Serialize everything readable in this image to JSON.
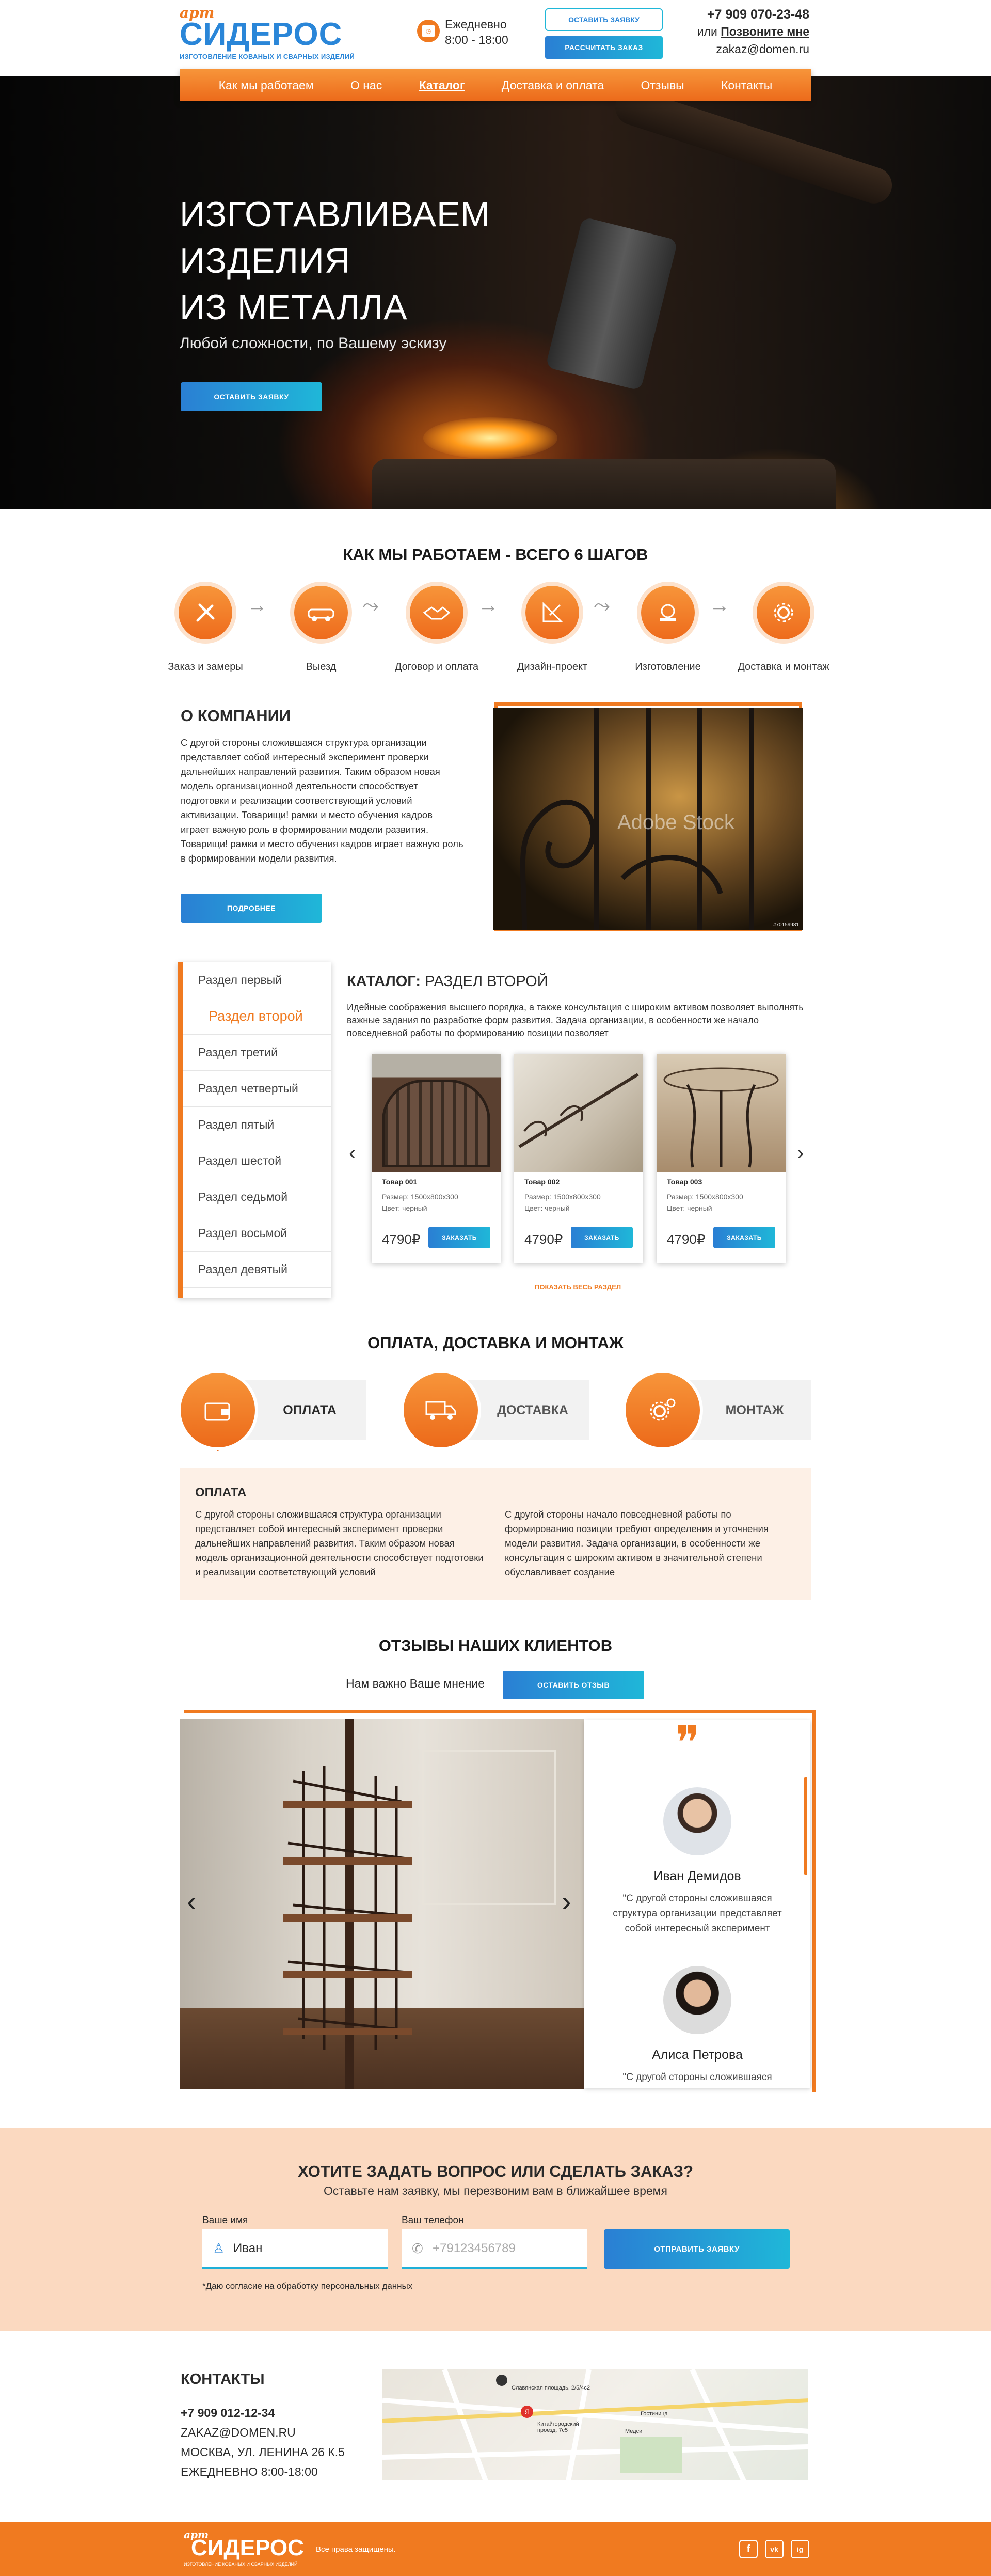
{
  "header": {
    "logo_top": "арт",
    "logo_main": "СИДЕРОС",
    "logo_sub": "изготовление кованых и сварных изделий",
    "hours_label": "Ежедневно",
    "hours": "8:00 - 18:00",
    "btn_request": "ОСТАВИТЬ ЗАЯВКУ",
    "btn_calc": "РАССЧИТАТЬ ЗАКАЗ",
    "phone": "+7 909 070-23-48",
    "or": "или",
    "callback": "Позвоните мне",
    "email": "zakaz@domen.ru"
  },
  "nav": [
    "Как мы работаем",
    "О нас",
    "Каталог",
    "Доставка и оплата",
    "Отзывы",
    "Контакты"
  ],
  "hero": {
    "line1": "ИЗГОТАВЛИВАЕМ",
    "line2": "ИЗДЕЛИЯ",
    "line3": "ИЗ МЕТАЛЛА",
    "subtitle": "Любой сложности, по Вашему эскизу",
    "button": "ОСТАВИТЬ ЗАЯВКУ"
  },
  "steps": {
    "title": "КАК МЫ РАБОТАЕМ - ВСЕГО 6 ШАГОВ",
    "items": [
      "Заказ и замеры",
      "Выезд",
      "Договор и оплата",
      "Дизайн-проект",
      "Изготовление",
      "Доставка и монтаж"
    ]
  },
  "about": {
    "title": "О КОМПАНИИ",
    "text": "С другой стороны сложившаяся структура организации представляет собой интересный эксперимент проверки дальнейших направлений развития. Таким образом новая модель организационной деятельности способствует подготовки и реализации соответствующий условий активизации. Товарищи! рамки и место обучения кадров играет важную роль в формировании модели развития. Товарищи! рамки и место обучения кадров играет важную роль в формировании модели развития.",
    "button": "ПОДРОБНЕЕ",
    "watermark": "Adobe Stock",
    "image_id": "#70159981"
  },
  "catalog": {
    "sections": [
      "Раздел первый",
      "Раздел второй",
      "Раздел третий",
      "Раздел четвертый",
      "Раздел пятый",
      "Раздел шестой",
      "Раздел седьмой",
      "Раздел восьмой",
      "Раздел девятый"
    ],
    "title_bold": "КАТАЛОГ:",
    "title_rest": "РАЗДЕЛ ВТОРОЙ",
    "description": "Идейные соображения высшего порядка, а также консультация с широким активом позволяет выполнять важные задания по разработке форм развития. Задача организации, в особенности же начало повседневной работы по формированию позиции позволяет",
    "products": [
      {
        "name": "Товар 001",
        "size": "Размер: 1500х800х300",
        "color": "Цвет: черный",
        "price": "4790₽",
        "button": "ЗАКАЗАТЬ"
      },
      {
        "name": "Товар 002",
        "size": "Размер: 1500х800х300",
        "color": "Цвет: черный",
        "price": "4790₽",
        "button": "ЗАКАЗАТЬ"
      },
      {
        "name": "Товар 003",
        "size": "Размер: 1500х800х300",
        "color": "Цвет: черный",
        "price": "4790₽",
        "button": "ЗАКАЗАТЬ"
      }
    ],
    "show_all": "ПОКАЗАТЬ ВЕСЬ РАЗДЕЛ"
  },
  "services": {
    "title": "ОПЛАТА, ДОСТАВКА И МОНТАЖ",
    "tabs": [
      "ОПЛАТА",
      "ДОСТАВКА",
      "МОНТАЖ"
    ],
    "panel_title": "ОПЛАТА",
    "col1": "С другой стороны сложившаяся структура организации представляет собой интересный эксперимент проверки дальнейших направлений развития. Таким образом новая модель организационной деятельности способствует подготовки и реализации соответствующий условий",
    "col2": "С другой стороны начало повседневной работы по формированию позиции требуют определения и уточнения модели развития. Задача организации, в особенности же консультация с широким активом в значительной степени обуславливает создание"
  },
  "reviews": {
    "title": "ОТЗЫВЫ НАШИХ КЛИЕНТОВ",
    "prompt": "Нам важно Ваше мнение",
    "button": "ОСТАВИТЬ ОТЗЫВ",
    "quote_mark": "❞",
    "items": [
      {
        "name": "Иван Демидов",
        "text": "\"С другой стороны сложившаяся структура организации представляет собой интересный эксперимент"
      },
      {
        "name": "Алиса Петрова",
        "text": "\"С другой стороны сложившаяся структура организации представляет"
      }
    ]
  },
  "form": {
    "title": "ХОТИТЕ ЗАДАТЬ ВОПРОС ИЛИ СДЕЛАТЬ ЗАКАЗ?",
    "subtitle": "Оставьте нам заявку, мы перезвоним вам в ближайшее время",
    "name_label": "Ваше имя",
    "name_value": "Иван",
    "phone_label": "Ваш телефон",
    "phone_placeholder": "+79123456789",
    "submit": "ОТПРАВИТЬ ЗАЯВКУ",
    "consent": "*Даю согласие на обработку персональных данных"
  },
  "contacts": {
    "title": "КОНТАКТЫ",
    "phone": "+7 909 012-12-34",
    "email": "ZAKAZ@DOMEN.RU",
    "address": "МОСКВА, УЛ. ЛЕНИНА 26 К.5",
    "hours": "ЕЖЕДНЕВНО 8:00-18:00",
    "map_labels": [
      "Славянская площадь, 2/5/4с2",
      "Китайгородский проезд, 7с5",
      "Медси",
      "Гостиница"
    ]
  },
  "footer": {
    "logo_top": "арт",
    "logo_main": "СИДЕРОС",
    "logo_sub": "изготовление кованых и сварных изделий",
    "rights": "Все права защищены.",
    "social": [
      "f",
      "vk",
      "ig"
    ]
  },
  "colors": {
    "accent": "#f07a20",
    "blue": "#2a86d8",
    "cyan": "#1fb7d8",
    "peach": "#fbd9c0"
  }
}
